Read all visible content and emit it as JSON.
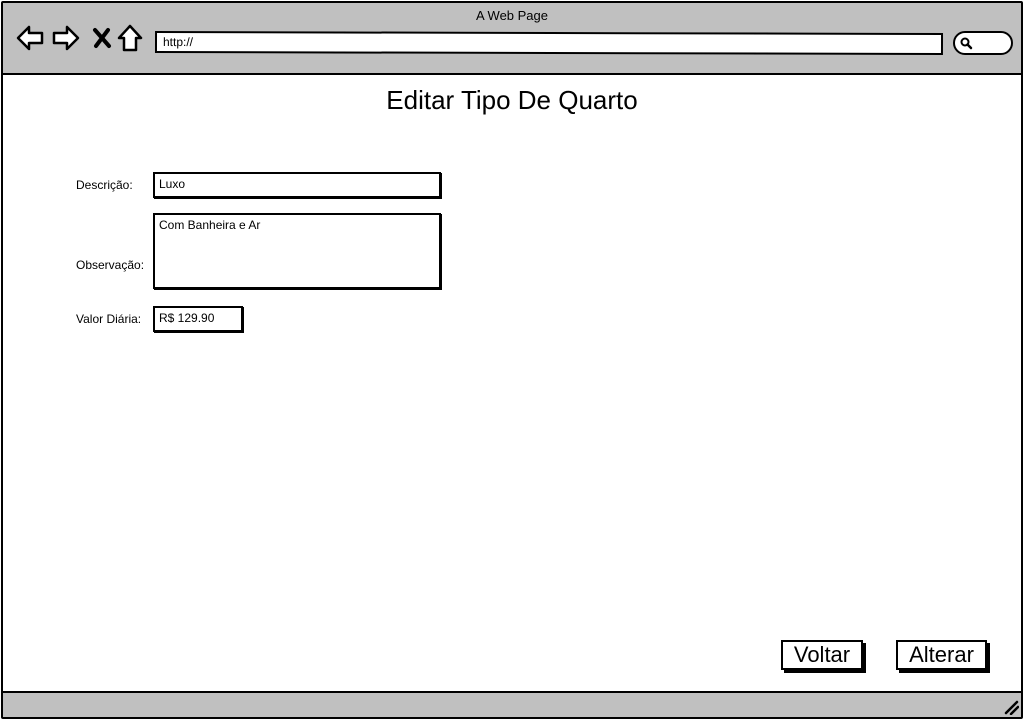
{
  "window": {
    "title": "A Web Page"
  },
  "toolbar": {
    "url": "http://"
  },
  "icons": {
    "back": "arrow-left-icon",
    "forward": "arrow-right-icon",
    "stop": "close-icon",
    "home": "home-icon",
    "search": "search-icon",
    "resize": "resize-grip-icon"
  },
  "page": {
    "title": "Editar Tipo De Quarto",
    "fields": {
      "descricao": {
        "label": "Descrição:",
        "value": "Luxo"
      },
      "observacao": {
        "label": "Observação:",
        "value": "Com Banheira e Ar"
      },
      "valor_diaria": {
        "label": "Valor Diária:",
        "value": "R$ 129.90"
      }
    },
    "buttons": {
      "voltar": "Voltar",
      "alterar": "Alterar"
    }
  }
}
